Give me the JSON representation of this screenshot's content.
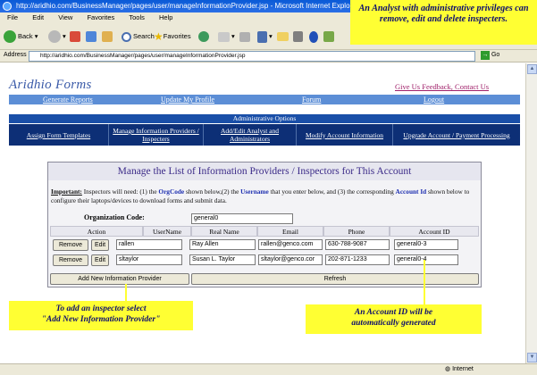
{
  "window": {
    "title": "http://aridhio.com/BusinessManager/pages/user/manageInformationProvider.jsp - Microsoft Internet Explorer",
    "menu": [
      "File",
      "Edit",
      "View",
      "Favorites",
      "Tools",
      "Help"
    ],
    "toolbar": {
      "back": "Back",
      "search": "Search",
      "favorites": "Favorites"
    },
    "address_label": "Address",
    "address_value": "http://aridhio.com/BusinessManager/pages/user/manageInformationProvider.jsp",
    "go_label": "Go",
    "status_zone": "Internet"
  },
  "site": {
    "logo": "Aridhio Forms",
    "feedback_link": "Give Us Feedback, Contact Us",
    "nav": [
      "Generate Reports",
      "Update My Profile",
      "Forum",
      "Logout"
    ],
    "admin_title": "Administrative Options",
    "admin_nav": [
      "Assign Form Templates",
      "Manage Information Providers / Inspecters",
      "Add/Edit Analyst and Administrators",
      "Modify Account Information",
      "Upgrade Account / Payment Processing"
    ]
  },
  "panel": {
    "title": "Manage the List of Information Providers / Inspectors for This Account",
    "note_important": "Important:",
    "note_part1": " Inspectors will need: (1) the ",
    "note_orgcode": "OrgCode",
    "note_part2": " shown below,(2) the ",
    "note_username": "Username",
    "note_part3": " that you enter below, and (3) the corresponding ",
    "note_accountid": "Account Id",
    "note_part4": " shown below to configure their laptops/devices to download forms and submit data.",
    "org_label": "Organization Code:",
    "org_value": "general0",
    "columns": [
      "Action",
      "UserName",
      "Real Name",
      "Email",
      "Phone",
      "Account ID"
    ],
    "rows": [
      {
        "remove": "Remove",
        "edit": "Edit",
        "username": "rallen",
        "realname": "Ray Allen",
        "email": "rallen@genco.com",
        "phone": "630-788-9087",
        "account": "general0-3"
      },
      {
        "remove": "Remove",
        "edit": "Edit",
        "username": "sltaylor",
        "realname": "Susan L. Taylor",
        "email": "sltaylor@genco.cor",
        "phone": "202-871-1233",
        "account": "general0-4"
      }
    ],
    "add_button": "Add New Information Provider",
    "refresh_button": "Refresh"
  },
  "callouts": {
    "top": "An Analyst with administrative privileges can remove, edit and delete inspecters.",
    "left_line1": "To add an inspector select",
    "left_line2": "\"Add New Information Provider\"",
    "right_line1": "An Account ID will be",
    "right_line2": "automatically generated"
  }
}
